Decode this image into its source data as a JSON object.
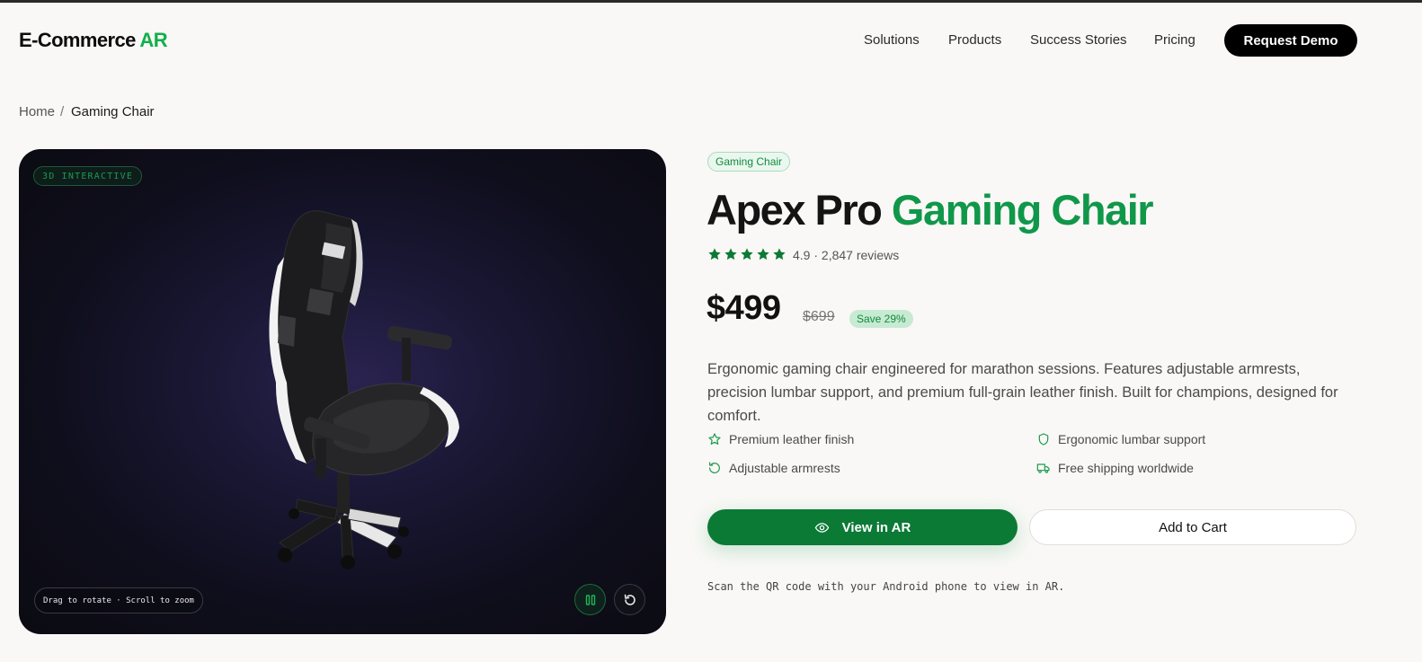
{
  "header": {
    "logo_main": "E-Commerce",
    "logo_accent": "AR",
    "nav": [
      "Solutions",
      "Products",
      "Success Stories",
      "Pricing"
    ],
    "cta_label": "Request Demo"
  },
  "breadcrumb": {
    "home": "Home",
    "separator": "/",
    "current": "Gaming Chair"
  },
  "viewer": {
    "badge": "3D INTERACTIVE",
    "hint": "Drag to rotate · Scroll to zoom",
    "controls": [
      "pause-icon",
      "reset-icon"
    ]
  },
  "product": {
    "category": "Gaming Chair",
    "title_main": "Apex Pro",
    "title_accent": "Gaming Chair",
    "stars": 5,
    "rating_text": "4.9 · 2,847 reviews",
    "price": "$499",
    "old_price": "$699",
    "save": "Save 29%",
    "description": "Ergonomic gaming chair engineered for marathon sessions. Features adjustable armrests, precision lumbar support, and premium full-grain leather finish. Built for champions, designed for comfort.",
    "features": [
      {
        "icon": "star-icon",
        "label": "Premium leather finish"
      },
      {
        "icon": "shield-icon",
        "label": "Ergonomic lumbar support"
      },
      {
        "icon": "rotate-icon",
        "label": "Adjustable armrests"
      },
      {
        "icon": "truck-icon",
        "label": "Free shipping worldwide"
      }
    ],
    "ar_button": "View in AR",
    "cart_button": "Add to Cart",
    "note": "Scan the QR code with your Android phone to view in AR."
  },
  "colors": {
    "accent": "#10974a",
    "button_green": "#0b7a35",
    "background": "#f9f8f6"
  }
}
